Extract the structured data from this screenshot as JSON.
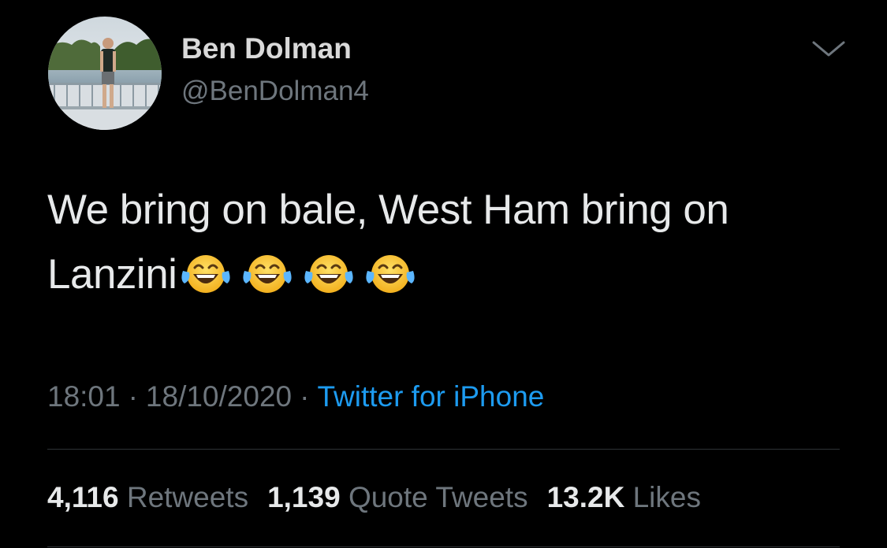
{
  "author": {
    "display_name": "Ben Dolman",
    "handle": "@BenDolman4"
  },
  "tweet": {
    "text": "We bring on bale, West Ham bring on Lanzini",
    "emojis": [
      "face-with-tears-of-joy",
      "face-with-tears-of-joy",
      "face-with-tears-of-joy",
      "face-with-tears-of-joy"
    ]
  },
  "meta": {
    "time": "18:01",
    "separator": "·",
    "date": "18/10/2020",
    "source": "Twitter for iPhone"
  },
  "stats": {
    "retweets_count": "4,116",
    "retweets_label": "Retweets",
    "quote_count": "1,139",
    "quote_label": "Quote Tweets",
    "likes_count": "13.2K",
    "likes_label": "Likes"
  },
  "colors": {
    "background": "#000000",
    "text_primary": "#e7e9ea",
    "text_secondary": "#6e767d",
    "link": "#1d9bf0",
    "divider": "#2f3336"
  },
  "icons": {
    "more": "chevron-down-icon"
  }
}
